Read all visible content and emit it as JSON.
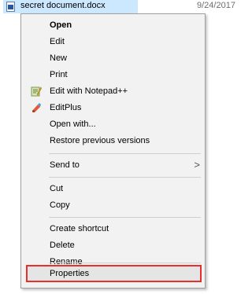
{
  "file": {
    "name": "secret document.docx",
    "date": "9/24/2017"
  },
  "menu": {
    "items": [
      {
        "label": "Open",
        "icon": "",
        "bold": true
      },
      {
        "label": "Edit",
        "icon": ""
      },
      {
        "label": "New",
        "icon": ""
      },
      {
        "label": "Print",
        "icon": ""
      },
      {
        "label": "Edit with Notepad++",
        "icon": "notepadpp-icon"
      },
      {
        "label": "EditPlus",
        "icon": "editplus-icon"
      },
      {
        "label": "Open with...",
        "icon": ""
      },
      {
        "label": "Restore previous versions",
        "icon": ""
      },
      {
        "label": "Send to",
        "icon": "",
        "submenu": true
      },
      {
        "label": "Cut",
        "icon": ""
      },
      {
        "label": "Copy",
        "icon": ""
      },
      {
        "label": "Create shortcut",
        "icon": ""
      },
      {
        "label": "Delete",
        "icon": ""
      },
      {
        "label": "Rename",
        "icon": ""
      },
      {
        "label": "Properties",
        "icon": "",
        "highlighted": true
      }
    ],
    "submenu_glyph": ">"
  },
  "colors": {
    "highlight_border": "#e8302a",
    "selection_bg": "#cce8ff",
    "menu_bg": "#f2f2f2"
  }
}
